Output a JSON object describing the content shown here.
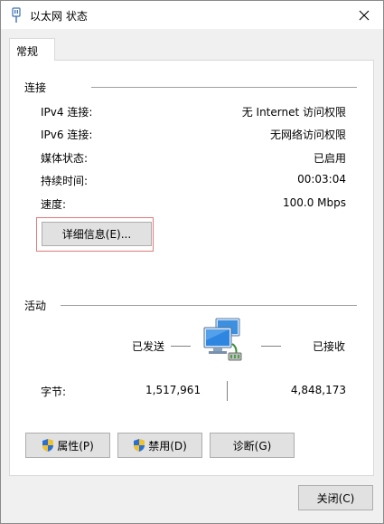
{
  "window": {
    "title": "以太网 状态",
    "close_icon": "close-icon"
  },
  "tabs": [
    {
      "label": "常规"
    }
  ],
  "connection": {
    "section_title": "连接",
    "rows": [
      {
        "label": "IPv4 连接:",
        "value": "无 Internet 访问权限"
      },
      {
        "label": "IPv6 连接:",
        "value": "无网络访问权限"
      },
      {
        "label": "媒体状态:",
        "value": "已启用"
      },
      {
        "label": "持续时间:",
        "value": "00:03:04"
      },
      {
        "label": "速度:",
        "value": "100.0 Mbps"
      }
    ],
    "details_button": "详细信息(E)..."
  },
  "activity": {
    "section_title": "活动",
    "sent_label": "已发送",
    "received_label": "已接收",
    "bytes_label": "字节:",
    "bytes_sent": "1,517,961",
    "bytes_received": "4,848,173"
  },
  "buttons": {
    "properties": "属性(P)",
    "disable": "禁用(D)",
    "diagnose": "诊断(G)",
    "close": "关闭(C)"
  },
  "colors": {
    "highlight_border": "#e07a7a",
    "shield_blue": "#2a6fd6",
    "shield_yellow": "#f2c12e"
  }
}
